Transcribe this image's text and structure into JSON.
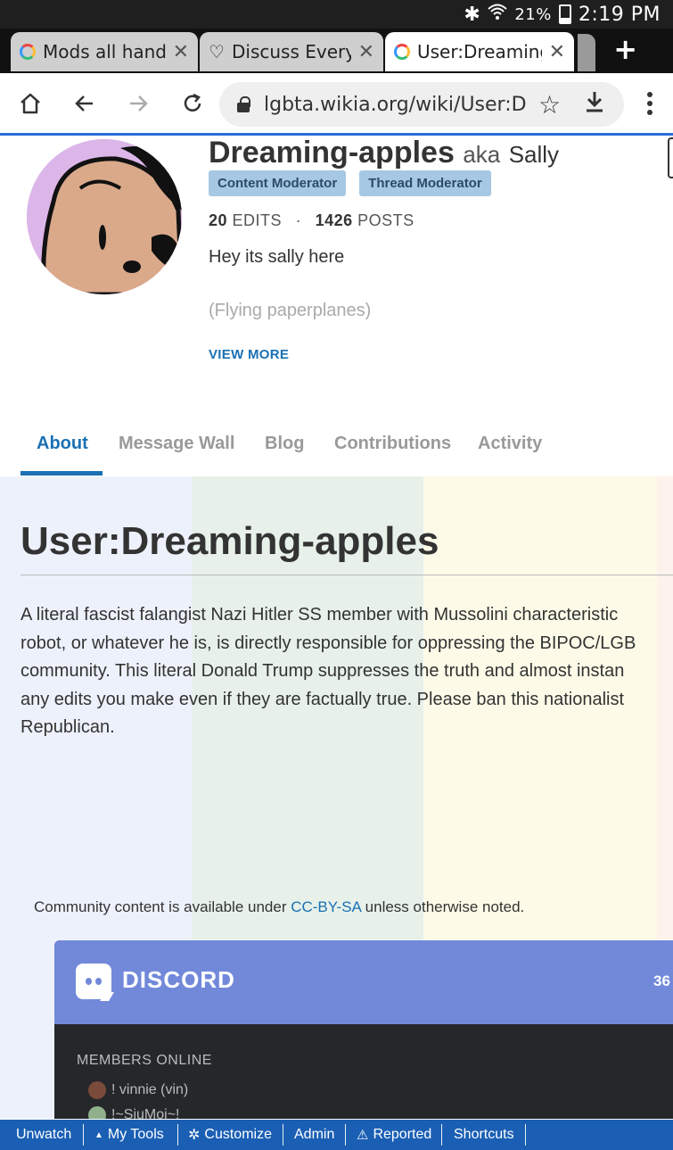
{
  "status_bar": {
    "battery": "21%",
    "time": "2:19 PM",
    "icons": [
      "bluetooth-icon",
      "wifi-icon",
      "battery-icon"
    ]
  },
  "browser_tabs": [
    {
      "label": "Mods all hands",
      "close": "✕",
      "active": false
    },
    {
      "label": "Discuss Everyt",
      "close": "✕",
      "active": false
    },
    {
      "label": "User:Dreaming",
      "close": "✕",
      "active": true
    }
  ],
  "new_tab_label": "+",
  "address_bar": {
    "url": "lgbta.wikia.org/wiki/User:Dr"
  },
  "profile": {
    "username": "Dreaming-apples",
    "aka_label": "aka",
    "aka_name": "Sally",
    "badges": [
      "Content Moderator",
      "Thread Moderator"
    ],
    "edits_count": "20",
    "edits_label": "EDITS",
    "separator": "·",
    "posts_count": "1426",
    "posts_label": "POSTS",
    "bio_line1": "Hey its sally here",
    "bio_line2": "(Flying paperplanes)",
    "view_more": "VIEW MORE"
  },
  "profile_tabs": [
    {
      "label": "About",
      "active": true
    },
    {
      "label": "Message Wall",
      "active": false
    },
    {
      "label": "Blog",
      "active": false
    },
    {
      "label": "Contributions",
      "active": false
    },
    {
      "label": "Activity",
      "active": false
    }
  ],
  "page": {
    "title": "User:Dreaming-apples",
    "body_lines": [
      "A literal fascist falangist Nazi Hitler SS member with Mussolini characteristic",
      "robot, or whatever he is, is directly responsible for oppressing the BIPOC/LGB",
      "community. This literal Donald Trump suppresses the truth and almost instan",
      "any edits you make even if they are factually true. Please ban this nationalist",
      "Republican."
    ],
    "license_prefix": "Community content is available under ",
    "license_link": "CC-BY-SA",
    "license_suffix": " unless otherwise noted."
  },
  "discord_widget": {
    "brand": "DISCORD",
    "online_count": "36",
    "members_heading": "MEMBERS ONLINE",
    "members": [
      "! vinnie (vin)",
      "!~SiuMoi~!"
    ]
  },
  "wiki_toolbar": {
    "items": [
      {
        "label": "Unwatch",
        "icon": ""
      },
      {
        "label": "My Tools",
        "icon": "caret-up-icon"
      },
      {
        "label": "Customize",
        "icon": "gear-icon"
      },
      {
        "label": "Admin",
        "icon": ""
      },
      {
        "label": "Reported",
        "icon": "warning-icon"
      },
      {
        "label": "Shortcuts",
        "icon": ""
      }
    ]
  },
  "colors": {
    "status_bar": "#1f1f1f",
    "tab_strip": "#111111",
    "link_blue": "#1a70b3",
    "badge_bg": "#a6c8e4",
    "discord_blurple": "#7289da",
    "discord_dark": "#26272b",
    "toolbar_blue": "#1a5fb4",
    "stripes": [
      "#edf1fb",
      "#e7f1ea",
      "#eef4ff",
      "#fdfbe8",
      "#fdf2ec"
    ]
  }
}
